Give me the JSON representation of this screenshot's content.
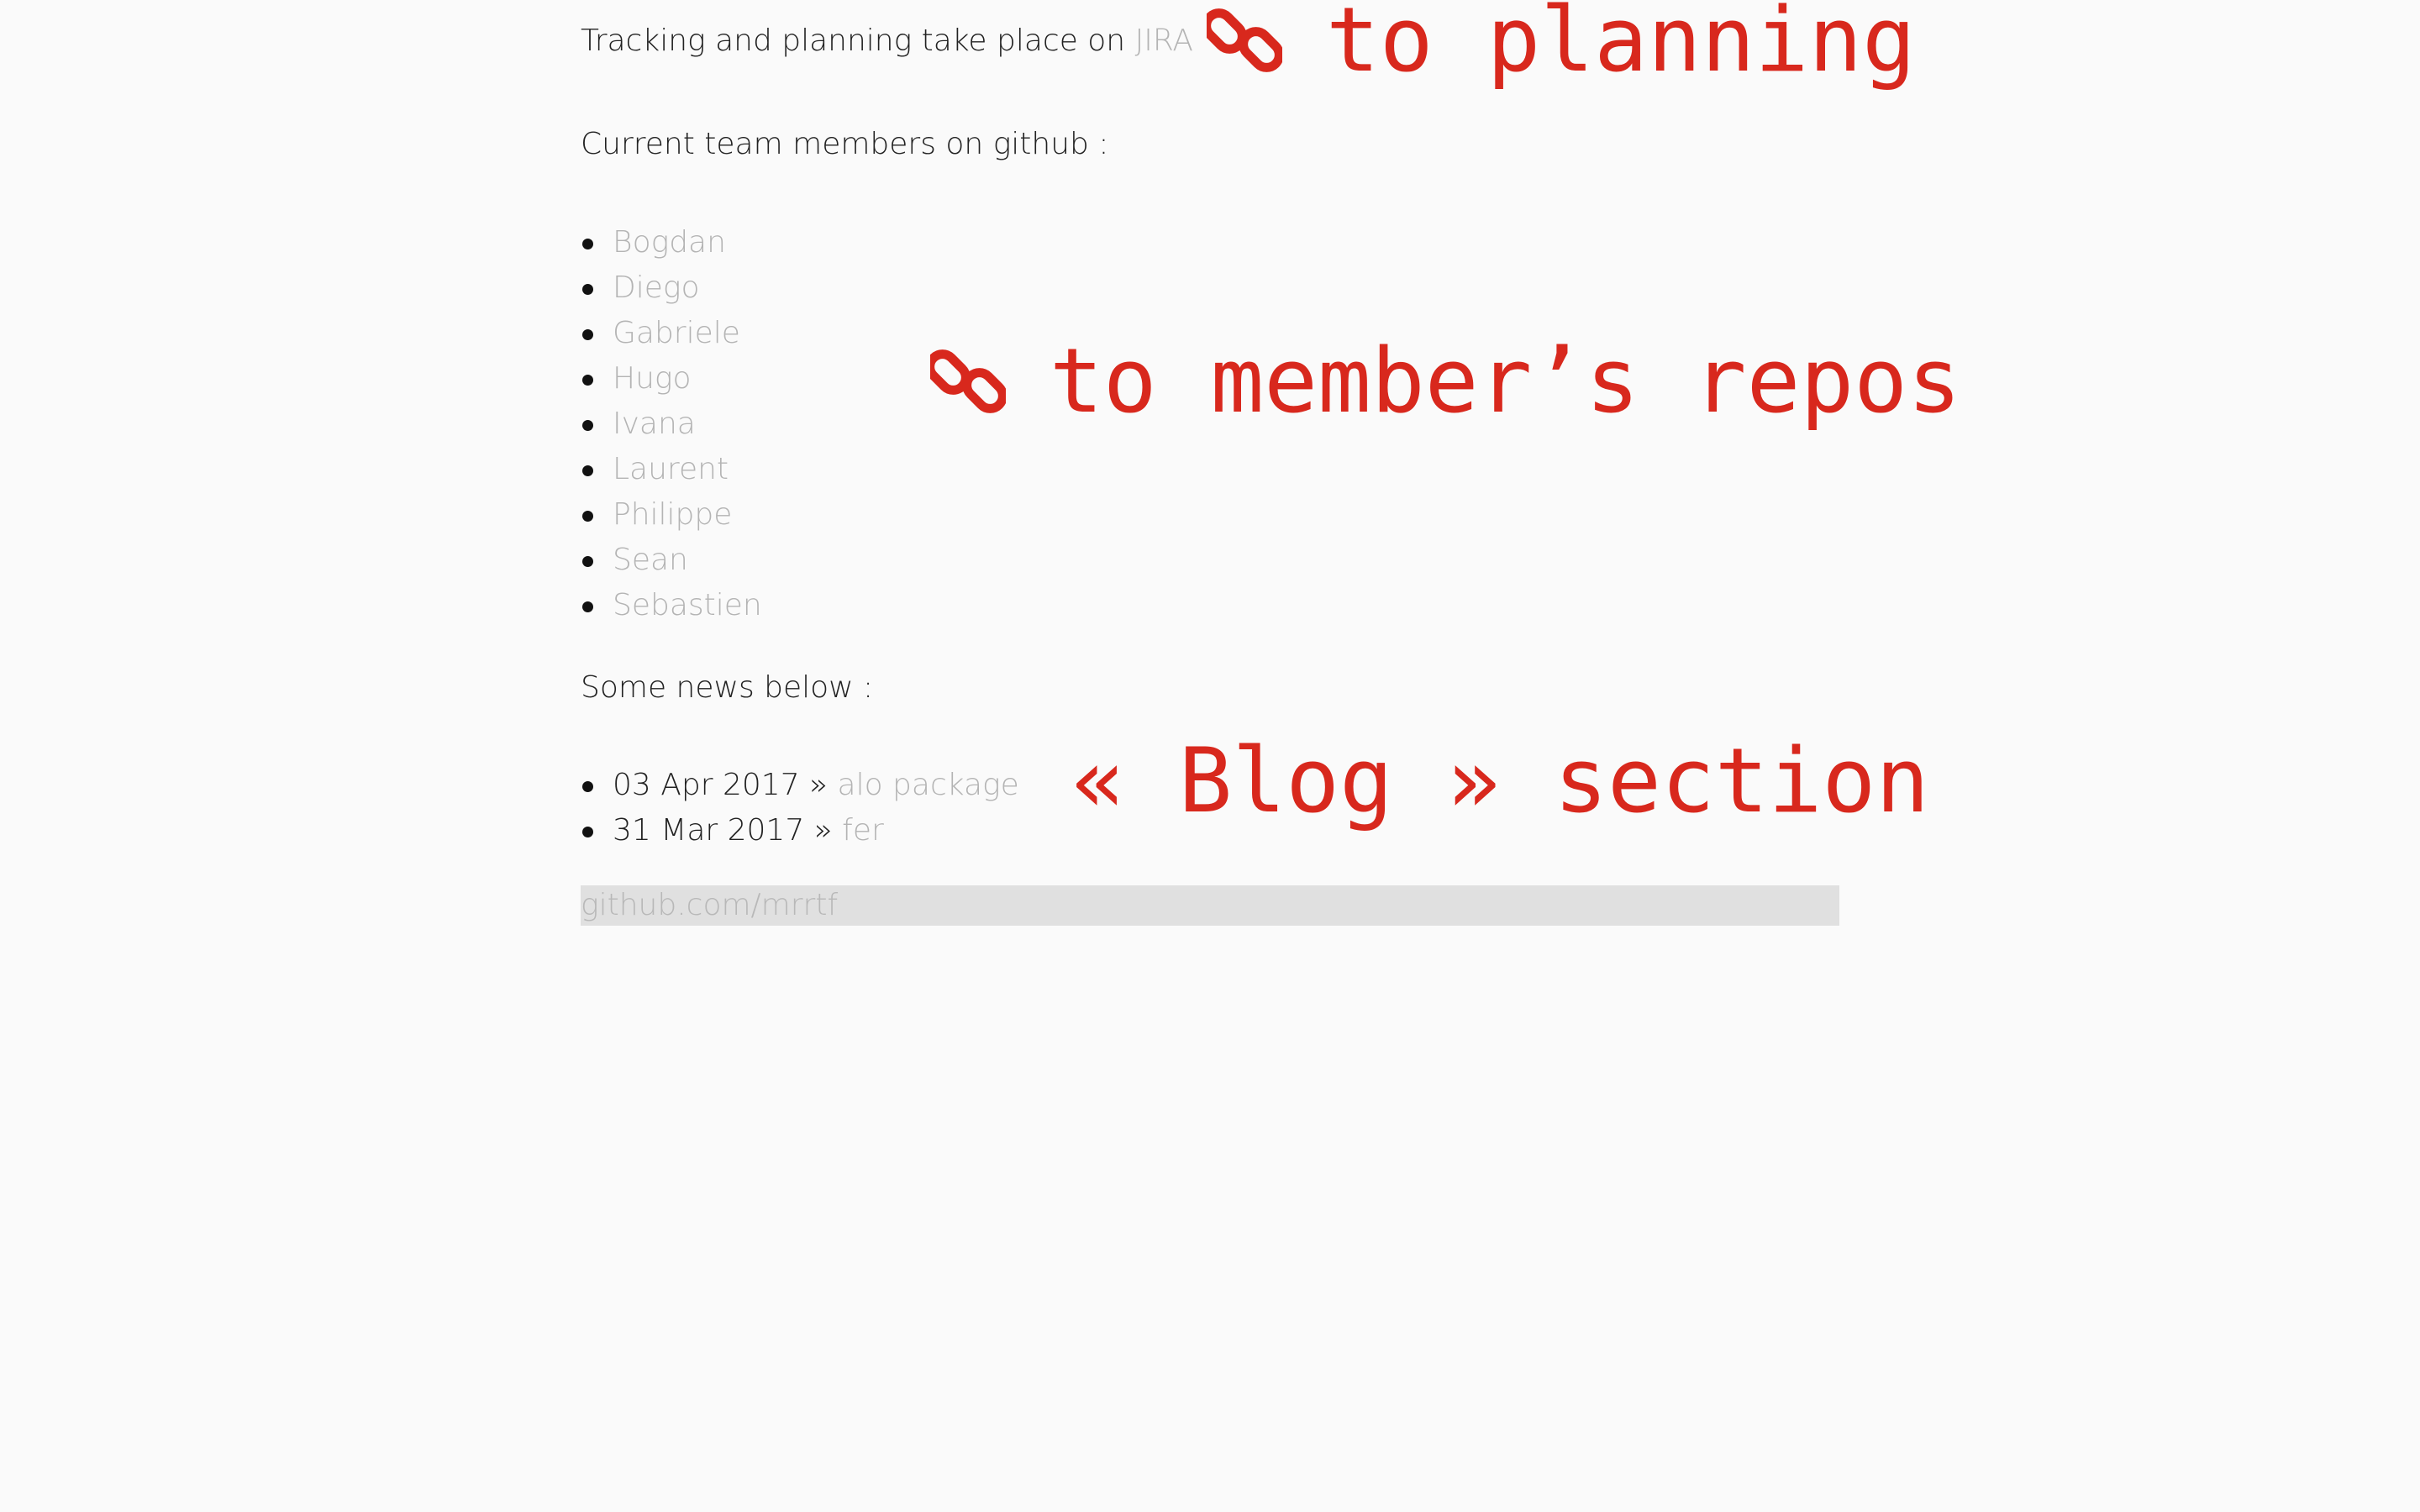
{
  "intro": {
    "text": "Tracking and planning take place on ",
    "jira_link": "JIRA"
  },
  "members": {
    "heading": "Current team members on github :",
    "items": [
      "Bogdan",
      "Diego",
      "Gabriele",
      "Hugo",
      "Ivana",
      "Laurent",
      "Philippe",
      "Sean",
      "Sebastien"
    ]
  },
  "news": {
    "heading": "Some news below :",
    "items": [
      {
        "date": "03 Apr 2017",
        "sep": " » ",
        "title": "alo package"
      },
      {
        "date": "31 Mar 2017",
        "sep": " » ",
        "title": "fer"
      }
    ]
  },
  "footer": {
    "link": "github.com/mrrtf"
  },
  "annotations": {
    "planning": "to planning",
    "repos": "to member’s repos",
    "blog": "« Blog » section",
    "icon": "chain-link-icon"
  },
  "colors": {
    "link": "#b4b4b4",
    "annotation": "#d8281d",
    "footer_bg": "#e0e0e0",
    "background": "#fafafa"
  }
}
